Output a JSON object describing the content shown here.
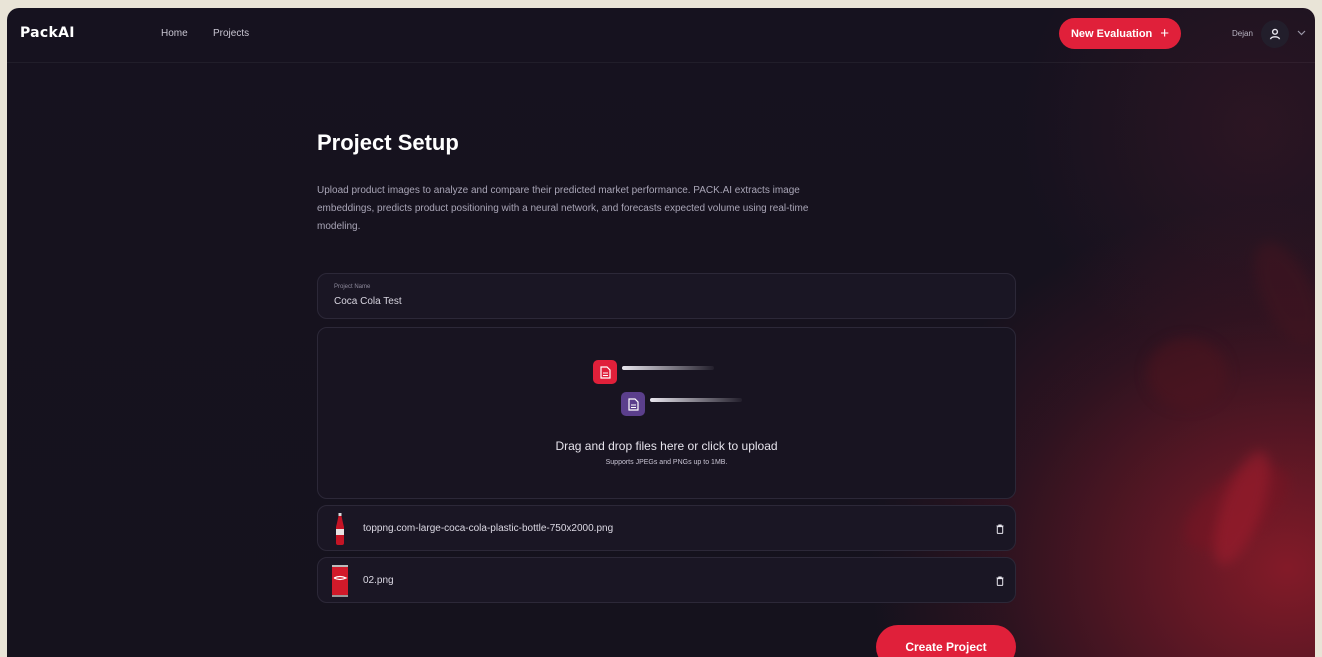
{
  "app": {
    "logo": "PackAI"
  },
  "nav": {
    "home": "Home",
    "projects": "Projects"
  },
  "header": {
    "new_evaluation": "New Evaluation",
    "new_evaluation_icon": "+",
    "user_name": "Dejan"
  },
  "page": {
    "title": "Project Setup",
    "description": "Upload product images to analyze and compare their predicted market performance. PACK.AI extracts image embeddings, predicts product positioning with a neural network, and forecasts expected volume using real-time modeling."
  },
  "project_name": {
    "label": "Project Name",
    "value": "Coca Cola Test"
  },
  "upload": {
    "main_text": "Drag and drop files here or click to upload",
    "sub_text": "Supports JPEGs and PNGs up to 1MB."
  },
  "files": [
    {
      "name": "toppng.com-large-coca-cola-plastic-bottle-750x2000.png",
      "thumb_icon": "coca-cola-bottle-thumbnail"
    },
    {
      "name": "02.png",
      "thumb_icon": "coca-cola-can-thumbnail"
    }
  ],
  "actions": {
    "create_project": "Create Project"
  },
  "colors": {
    "accent": "#e0203a",
    "background": "#15121d",
    "secondary": "#5b3f8c"
  }
}
